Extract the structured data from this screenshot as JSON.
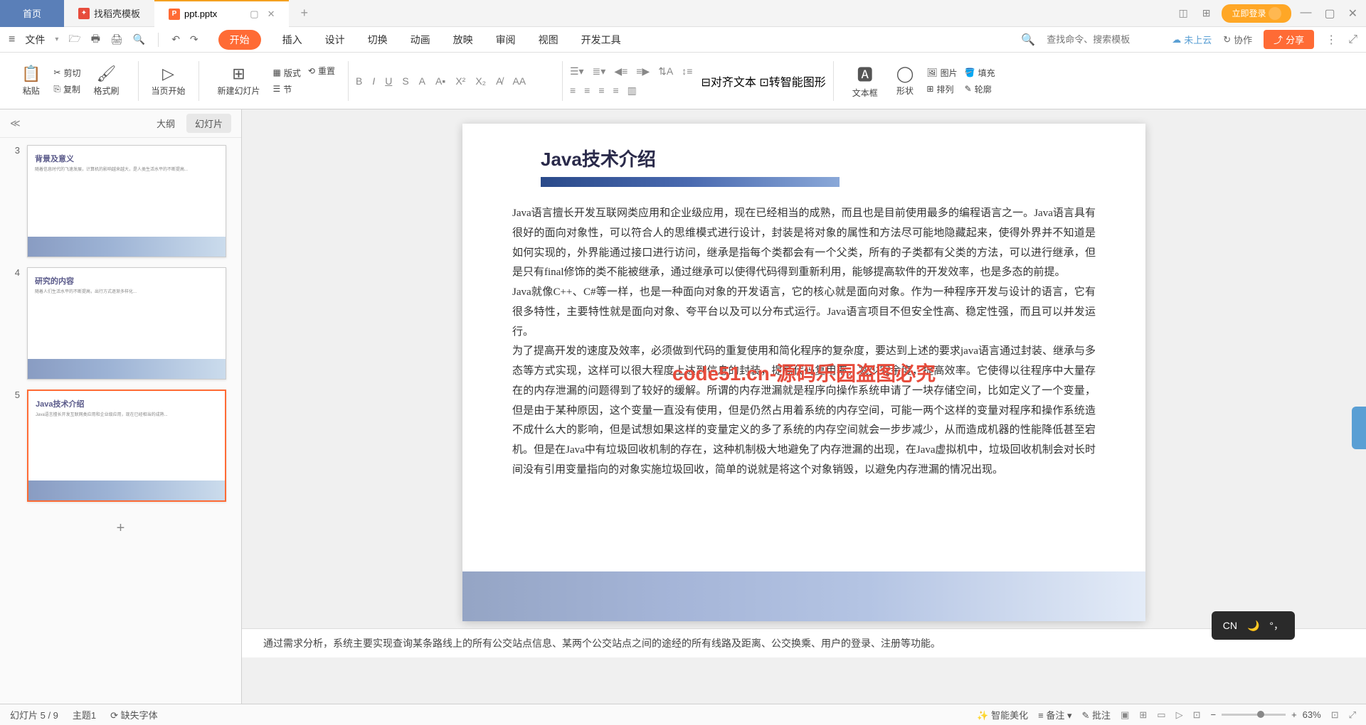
{
  "titlebar": {
    "home_tab": "首页",
    "template_tab": "找稻壳模板",
    "file_tab": "ppt.pptx",
    "login": "立即登录"
  },
  "menubar": {
    "file": "文件",
    "tabs": [
      "开始",
      "插入",
      "设计",
      "切换",
      "动画",
      "放映",
      "审阅",
      "视图",
      "开发工具"
    ],
    "search_placeholder": "查找命令、搜索模板",
    "cloud": "未上云",
    "collab": "协作",
    "share": "分享"
  },
  "ribbon": {
    "paste": "粘贴",
    "cut": "剪切",
    "copy": "复制",
    "format_painter": "格式刷",
    "from_current": "当页开始",
    "new_slide": "新建幻灯片",
    "layout": "版式",
    "section": "节",
    "reset": "重置",
    "align_text": "对齐文本",
    "smart_graphic": "转智能图形",
    "textbox": "文本框",
    "shape": "形状",
    "picture": "图片",
    "arrange": "排列",
    "fill": "填充",
    "outline": "轮廓"
  },
  "sidebar": {
    "outline": "大纲",
    "slides": "幻灯片",
    "thumbs": [
      {
        "num": "3",
        "title": "背景及意义"
      },
      {
        "num": "4",
        "title": "研究的内容"
      },
      {
        "num": "5",
        "title": "Java技术介绍"
      }
    ]
  },
  "slide": {
    "title": "Java技术介绍",
    "body": "Java语言擅长开发互联网类应用和企业级应用，现在已经相当的成熟，而且也是目前使用最多的编程语言之一。Java语言具有很好的面向对象性，可以符合人的思维模式进行设计，封装是将对象的属性和方法尽可能地隐藏起来，使得外界并不知道是如何实现的，外界能通过接口进行访问，继承是指每个类都会有一个父类，所有的子类都有父类的方法，可以进行继承，但是只有final修饰的类不能被继承，通过继承可以使得代码得到重新利用，能够提高软件的开发效率，也是多态的前提。\nJava就像C++、C#等一样，也是一种面向对象的开发语言，它的核心就是面向对象。作为一种程序开发与设计的语言，它有很多特性，主要特性就是面向对象、夸平台以及可以分布式运行。Java语言项目不但安全性高、稳定性强，而且可以并发运行。\n为了提高开发的速度及效率，必须做到代码的重复使用和简化程序的复杂度，要达到上述的要求java语言通过封装、继承与多态等方式实现，这样可以很大程度上达到信息的封装，提高代码复用率，减少冗余度，提高效率。它使得以往程序中大量存在的内存泄漏的问题得到了较好的缓解。所谓的内存泄漏就是程序向操作系统申请了一块存储空间，比如定义了一个变量，但是由于某种原因，这个变量一直没有使用，但是仍然占用着系统的内存空间，可能一两个这样的变量对程序和操作系统造不成什么大的影响，但是试想如果这样的变量定义的多了系统的内存空间就会一步步减少，从而造成机器的性能降低甚至宕机。但是在Java中有垃圾回收机制的存在，这种机制极大地避免了内存泄漏的出现，在Java虚拟机中，垃圾回收机制会对长时间没有引用变量指向的对象实施垃圾回收，简单的说就是将这个对象销毁，以避免内存泄漏的情况出现。",
    "watermark": "code51.cn-源码乐园盗图必究"
  },
  "notes": "通过需求分析，系统主要实现查询某条路线上的所有公交站点信息、某两个公交站点之间的途经的所有线路及距离、公交换乘、用户的登录、注册等功能。",
  "statusbar": {
    "slide_pos": "幻灯片 5 / 9",
    "theme": "主题1",
    "missing_font": "缺失字体",
    "beautify": "智能美化",
    "notes_btn": "备注",
    "comments": "批注",
    "zoom": "63%"
  },
  "ime": {
    "lang": "CN"
  }
}
